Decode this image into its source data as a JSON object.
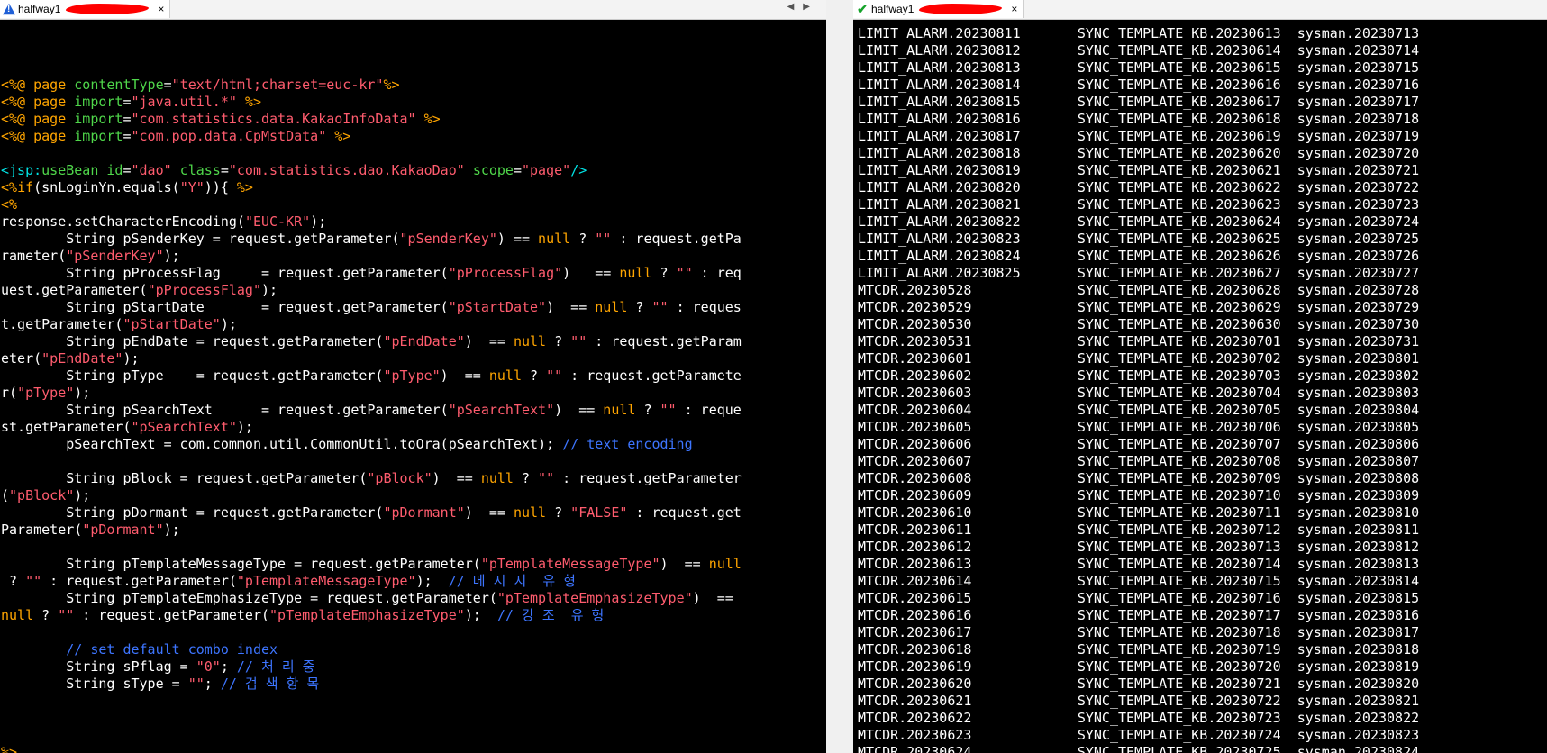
{
  "left_tab": {
    "title": "halfway1",
    "close": "×"
  },
  "right_tab": {
    "title": "halfway1",
    "close": "×"
  },
  "nav": {
    "prev": "◀",
    "next": "▶"
  },
  "editor_lines": [
    [],
    [],
    [],
    [
      [
        "o",
        "<%@ "
      ],
      [
        "o",
        "page "
      ],
      [
        "g",
        "contentType"
      ],
      [
        "t",
        "="
      ],
      [
        "r",
        "\"text/html;charset=euc-kr\""
      ],
      [
        "o",
        "%>"
      ]
    ],
    [
      [
        "o",
        "<%@ "
      ],
      [
        "o",
        "page "
      ],
      [
        "g",
        "import"
      ],
      [
        "t",
        "="
      ],
      [
        "r",
        "\"java.util.*\""
      ],
      [
        "t",
        " "
      ],
      [
        "o",
        "%>"
      ]
    ],
    [
      [
        "o",
        "<%@ "
      ],
      [
        "o",
        "page "
      ],
      [
        "g",
        "import"
      ],
      [
        "t",
        "="
      ],
      [
        "r",
        "\"com.statistics.data.KakaoInfoData\""
      ],
      [
        "t",
        " "
      ],
      [
        "o",
        "%>"
      ]
    ],
    [
      [
        "o",
        "<%@ "
      ],
      [
        "o",
        "page "
      ],
      [
        "g",
        "import"
      ],
      [
        "t",
        "="
      ],
      [
        "r",
        "\"com.pop.data.CpMstData\""
      ],
      [
        "t",
        " "
      ],
      [
        "o",
        "%>"
      ]
    ],
    [],
    [
      [
        "c",
        "<jsp:"
      ],
      [
        "g",
        "useBean "
      ],
      [
        "g",
        "id"
      ],
      [
        "t",
        "="
      ],
      [
        "r",
        "\"dao\""
      ],
      [
        "t",
        " "
      ],
      [
        "g",
        "class"
      ],
      [
        "t",
        "="
      ],
      [
        "r",
        "\"com.statistics.dao.KakaoDao\""
      ],
      [
        "t",
        " "
      ],
      [
        "g",
        "scope"
      ],
      [
        "t",
        "="
      ],
      [
        "r",
        "\"page\""
      ],
      [
        "c",
        "/>"
      ]
    ],
    [
      [
        "o",
        "<%"
      ],
      [
        "o",
        "if"
      ],
      [
        "t",
        "(snLoginYn.equals("
      ],
      [
        "r",
        "\"Y\""
      ],
      [
        "t",
        "))"
      ],
      [
        "t",
        "{ "
      ],
      [
        "o",
        "%>"
      ]
    ],
    [
      [
        "o",
        "<%"
      ]
    ],
    [
      [
        "t",
        "response.setCharacterEncoding("
      ],
      [
        "r",
        "\"EUC-KR\""
      ],
      [
        "t",
        ");"
      ]
    ],
    [
      [
        "t",
        "        String pSenderKey = request.getParameter("
      ],
      [
        "r",
        "\"pSenderKey\""
      ],
      [
        "t",
        ") == "
      ],
      [
        "o",
        "null"
      ],
      [
        "t",
        " ? "
      ],
      [
        "r",
        "\"\""
      ],
      [
        "t",
        " : request.getPa"
      ]
    ],
    [
      [
        "t",
        "rameter("
      ],
      [
        "r",
        "\"pSenderKey\""
      ],
      [
        "t",
        ");"
      ]
    ],
    [
      [
        "t",
        "        String pProcessFlag     = request.getParameter("
      ],
      [
        "r",
        "\"pProcessFlag\""
      ],
      [
        "t",
        ")   == "
      ],
      [
        "o",
        "null"
      ],
      [
        "t",
        " ? "
      ],
      [
        "r",
        "\"\""
      ],
      [
        "t",
        " : req"
      ]
    ],
    [
      [
        "t",
        "uest.getParameter("
      ],
      [
        "r",
        "\"pProcessFlag\""
      ],
      [
        "t",
        ");"
      ]
    ],
    [
      [
        "t",
        "        String pStartDate       = request.getParameter("
      ],
      [
        "r",
        "\"pStartDate\""
      ],
      [
        "t",
        ")  == "
      ],
      [
        "o",
        "null"
      ],
      [
        "t",
        " ? "
      ],
      [
        "r",
        "\"\""
      ],
      [
        "t",
        " : reques"
      ]
    ],
    [
      [
        "t",
        "t.getParameter("
      ],
      [
        "r",
        "\"pStartDate\""
      ],
      [
        "t",
        ");"
      ]
    ],
    [
      [
        "t",
        "        String pEndDate = request.getParameter("
      ],
      [
        "r",
        "\"pEndDate\""
      ],
      [
        "t",
        ")  == "
      ],
      [
        "o",
        "null"
      ],
      [
        "t",
        " ? "
      ],
      [
        "r",
        "\"\""
      ],
      [
        "t",
        " : request.getParam"
      ]
    ],
    [
      [
        "t",
        "eter("
      ],
      [
        "r",
        "\"pEndDate\""
      ],
      [
        "t",
        ");"
      ]
    ],
    [
      [
        "t",
        "        String pType    = request.getParameter("
      ],
      [
        "r",
        "\"pType\""
      ],
      [
        "t",
        ")  == "
      ],
      [
        "o",
        "null"
      ],
      [
        "t",
        " ? "
      ],
      [
        "r",
        "\"\""
      ],
      [
        "t",
        " : request.getParamete"
      ]
    ],
    [
      [
        "t",
        "r("
      ],
      [
        "r",
        "\"pType\""
      ],
      [
        "t",
        ");"
      ]
    ],
    [
      [
        "t",
        "        String pSearchText      = request.getParameter("
      ],
      [
        "r",
        "\"pSearchText\""
      ],
      [
        "t",
        ")  == "
      ],
      [
        "o",
        "null"
      ],
      [
        "t",
        " ? "
      ],
      [
        "r",
        "\"\""
      ],
      [
        "t",
        " : reque"
      ]
    ],
    [
      [
        "t",
        "st.getParameter("
      ],
      [
        "r",
        "\"pSearchText\""
      ],
      [
        "t",
        ");"
      ]
    ],
    [
      [
        "t",
        "        pSearchText = com.common.util.CommonUtil.toOra(pSearchText); "
      ],
      [
        "b",
        "// text encoding"
      ]
    ],
    [],
    [
      [
        "t",
        "        String pBlock = request.getParameter("
      ],
      [
        "r",
        "\"pBlock\""
      ],
      [
        "t",
        ")  == "
      ],
      [
        "o",
        "null"
      ],
      [
        "t",
        " ? "
      ],
      [
        "r",
        "\"\""
      ],
      [
        "t",
        " : request.getParameter"
      ]
    ],
    [
      [
        "t",
        "("
      ],
      [
        "r",
        "\"pBlock\""
      ],
      [
        "t",
        ");"
      ]
    ],
    [
      [
        "t",
        "        String pDormant = request.getParameter("
      ],
      [
        "r",
        "\"pDormant\""
      ],
      [
        "t",
        ")  == "
      ],
      [
        "o",
        "null"
      ],
      [
        "t",
        " ? "
      ],
      [
        "r",
        "\"FALSE\""
      ],
      [
        "t",
        " : request.get"
      ]
    ],
    [
      [
        "t",
        "Parameter("
      ],
      [
        "r",
        "\"pDormant\""
      ],
      [
        "t",
        ");"
      ]
    ],
    [],
    [
      [
        "t",
        "        String pTemplateMessageType = request.getParameter("
      ],
      [
        "r",
        "\"pTemplateMessageType\""
      ],
      [
        "t",
        ")  == "
      ],
      [
        "o",
        "null"
      ]
    ],
    [
      [
        "t",
        " ? "
      ],
      [
        "r",
        "\"\""
      ],
      [
        "t",
        " : request.getParameter("
      ],
      [
        "r",
        "\"pTemplateMessageType\""
      ],
      [
        "t",
        ");  "
      ],
      [
        "b",
        "// 메 시 지  유 형"
      ]
    ],
    [
      [
        "t",
        "        String pTemplateEmphasizeType = request.getParameter("
      ],
      [
        "r",
        "\"pTemplateEmphasizeType\""
      ],
      [
        "t",
        ")  =="
      ]
    ],
    [
      [
        "o",
        "null"
      ],
      [
        "t",
        " ? "
      ],
      [
        "r",
        "\"\""
      ],
      [
        "t",
        " : request.getParameter("
      ],
      [
        "r",
        "\"pTemplateEmphasizeType\""
      ],
      [
        "t",
        ");  "
      ],
      [
        "b",
        "// 강 조  유 형"
      ]
    ],
    [],
    [
      [
        "b",
        "        // set default combo index"
      ]
    ],
    [
      [
        "t",
        "        String sPflag = "
      ],
      [
        "r",
        "\"0\""
      ],
      [
        "t",
        "; "
      ],
      [
        "b",
        "// 처 리 중"
      ]
    ],
    [
      [
        "t",
        "        String sType = "
      ],
      [
        "r",
        "\"\""
      ],
      [
        "t",
        "; "
      ],
      [
        "b",
        "// 검 색 항 목"
      ]
    ],
    [],
    [],
    [],
    [
      [
        "o",
        "%>"
      ]
    ],
    [
      [
        "p",
        "<%--"
      ]
    ]
  ],
  "listing_rows": [
    [
      "LIMIT_ALARM.20230811",
      "SYNC_TEMPLATE_KB.20230613",
      "sysman.20230713"
    ],
    [
      "LIMIT_ALARM.20230812",
      "SYNC_TEMPLATE_KB.20230614",
      "sysman.20230714"
    ],
    [
      "LIMIT_ALARM.20230813",
      "SYNC_TEMPLATE_KB.20230615",
      "sysman.20230715"
    ],
    [
      "LIMIT_ALARM.20230814",
      "SYNC_TEMPLATE_KB.20230616",
      "sysman.20230716"
    ],
    [
      "LIMIT_ALARM.20230815",
      "SYNC_TEMPLATE_KB.20230617",
      "sysman.20230717"
    ],
    [
      "LIMIT_ALARM.20230816",
      "SYNC_TEMPLATE_KB.20230618",
      "sysman.20230718"
    ],
    [
      "LIMIT_ALARM.20230817",
      "SYNC_TEMPLATE_KB.20230619",
      "sysman.20230719"
    ],
    [
      "LIMIT_ALARM.20230818",
      "SYNC_TEMPLATE_KB.20230620",
      "sysman.20230720"
    ],
    [
      "LIMIT_ALARM.20230819",
      "SYNC_TEMPLATE_KB.20230621",
      "sysman.20230721"
    ],
    [
      "LIMIT_ALARM.20230820",
      "SYNC_TEMPLATE_KB.20230622",
      "sysman.20230722"
    ],
    [
      "LIMIT_ALARM.20230821",
      "SYNC_TEMPLATE_KB.20230623",
      "sysman.20230723"
    ],
    [
      "LIMIT_ALARM.20230822",
      "SYNC_TEMPLATE_KB.20230624",
      "sysman.20230724"
    ],
    [
      "LIMIT_ALARM.20230823",
      "SYNC_TEMPLATE_KB.20230625",
      "sysman.20230725"
    ],
    [
      "LIMIT_ALARM.20230824",
      "SYNC_TEMPLATE_KB.20230626",
      "sysman.20230726"
    ],
    [
      "LIMIT_ALARM.20230825",
      "SYNC_TEMPLATE_KB.20230627",
      "sysman.20230727"
    ],
    [
      "MTCDR.20230528",
      "SYNC_TEMPLATE_KB.20230628",
      "sysman.20230728"
    ],
    [
      "MTCDR.20230529",
      "SYNC_TEMPLATE_KB.20230629",
      "sysman.20230729"
    ],
    [
      "MTCDR.20230530",
      "SYNC_TEMPLATE_KB.20230630",
      "sysman.20230730"
    ],
    [
      "MTCDR.20230531",
      "SYNC_TEMPLATE_KB.20230701",
      "sysman.20230731"
    ],
    [
      "MTCDR.20230601",
      "SYNC_TEMPLATE_KB.20230702",
      "sysman.20230801"
    ],
    [
      "MTCDR.20230602",
      "SYNC_TEMPLATE_KB.20230703",
      "sysman.20230802"
    ],
    [
      "MTCDR.20230603",
      "SYNC_TEMPLATE_KB.20230704",
      "sysman.20230803"
    ],
    [
      "MTCDR.20230604",
      "SYNC_TEMPLATE_KB.20230705",
      "sysman.20230804"
    ],
    [
      "MTCDR.20230605",
      "SYNC_TEMPLATE_KB.20230706",
      "sysman.20230805"
    ],
    [
      "MTCDR.20230606",
      "SYNC_TEMPLATE_KB.20230707",
      "sysman.20230806"
    ],
    [
      "MTCDR.20230607",
      "SYNC_TEMPLATE_KB.20230708",
      "sysman.20230807"
    ],
    [
      "MTCDR.20230608",
      "SYNC_TEMPLATE_KB.20230709",
      "sysman.20230808"
    ],
    [
      "MTCDR.20230609",
      "SYNC_TEMPLATE_KB.20230710",
      "sysman.20230809"
    ],
    [
      "MTCDR.20230610",
      "SYNC_TEMPLATE_KB.20230711",
      "sysman.20230810"
    ],
    [
      "MTCDR.20230611",
      "SYNC_TEMPLATE_KB.20230712",
      "sysman.20230811"
    ],
    [
      "MTCDR.20230612",
      "SYNC_TEMPLATE_KB.20230713",
      "sysman.20230812"
    ],
    [
      "MTCDR.20230613",
      "SYNC_TEMPLATE_KB.20230714",
      "sysman.20230813"
    ],
    [
      "MTCDR.20230614",
      "SYNC_TEMPLATE_KB.20230715",
      "sysman.20230814"
    ],
    [
      "MTCDR.20230615",
      "SYNC_TEMPLATE_KB.20230716",
      "sysman.20230815"
    ],
    [
      "MTCDR.20230616",
      "SYNC_TEMPLATE_KB.20230717",
      "sysman.20230816"
    ],
    [
      "MTCDR.20230617",
      "SYNC_TEMPLATE_KB.20230718",
      "sysman.20230817"
    ],
    [
      "MTCDR.20230618",
      "SYNC_TEMPLATE_KB.20230719",
      "sysman.20230818"
    ],
    [
      "MTCDR.20230619",
      "SYNC_TEMPLATE_KB.20230720",
      "sysman.20230819"
    ],
    [
      "MTCDR.20230620",
      "SYNC_TEMPLATE_KB.20230721",
      "sysman.20230820"
    ],
    [
      "MTCDR.20230621",
      "SYNC_TEMPLATE_KB.20230722",
      "sysman.20230821"
    ],
    [
      "MTCDR.20230622",
      "SYNC_TEMPLATE_KB.20230723",
      "sysman.20230822"
    ],
    [
      "MTCDR.20230623",
      "SYNC_TEMPLATE_KB.20230724",
      "sysman.20230823"
    ],
    [
      "MTCDR.20230624",
      "SYNC_TEMPLATE_KB.20230725",
      "sysman.20230824"
    ]
  ]
}
